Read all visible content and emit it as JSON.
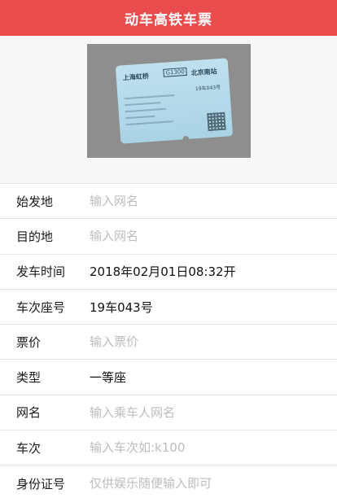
{
  "header": {
    "title": "动车高铁车票",
    "background_color": "#ea4c4d"
  },
  "photo": {
    "ticket_from": "上海虹桥",
    "ticket_train": "G1300",
    "ticket_to": "北京南站",
    "ticket_seat": "19车043号"
  },
  "form": {
    "departure": {
      "label": "始发地",
      "placeholder": "输入网名"
    },
    "destination": {
      "label": "目的地",
      "placeholder": "输入网名"
    },
    "depart_time": {
      "label": "发车时间",
      "value": "2018年02月01日08:32开"
    },
    "seat": {
      "label": "车次座号",
      "value": "19车043号"
    },
    "price": {
      "label": "票价",
      "placeholder": "输入票价"
    },
    "type": {
      "label": "类型",
      "value": "一等座"
    },
    "nickname": {
      "label": "网名",
      "placeholder": "输入乘车人网名"
    },
    "train_no": {
      "label": "车次",
      "placeholder": "输入车次如:k100"
    },
    "id_number": {
      "label": "身份证号",
      "placeholder": "仅供娱乐随便输入即可"
    }
  }
}
